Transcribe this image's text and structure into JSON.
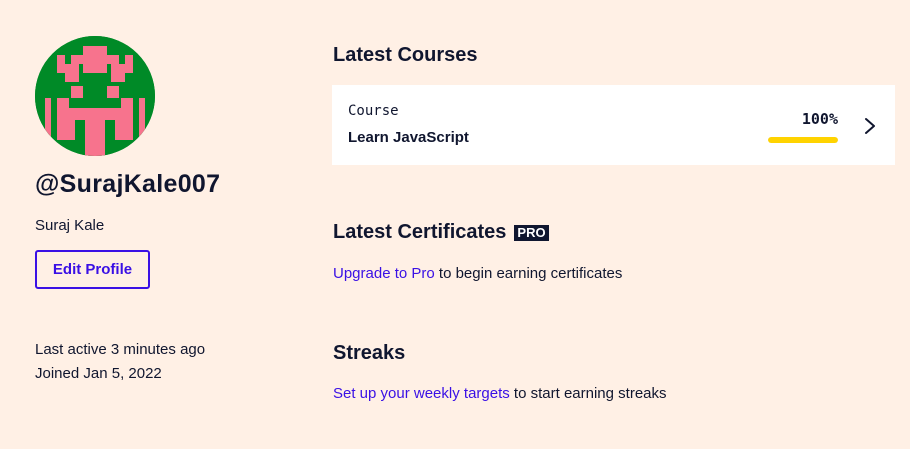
{
  "profile": {
    "username": "@SurajKale007",
    "full_name": "Suraj Kale",
    "edit_button_label": "Edit Profile",
    "last_active": "Last active 3 minutes ago",
    "joined": "Joined Jan 5, 2022",
    "avatar_colors": {
      "background": "#008a27",
      "pattern": "#f7738d"
    }
  },
  "latest_courses": {
    "heading": "Latest Courses",
    "card": {
      "type_label": "Course",
      "name": "Learn JavaScript",
      "progress_label": "100%",
      "progress_fraction": 1.0,
      "progress_color": "#ffd300",
      "chevron_icon": "chevron-right-icon"
    }
  },
  "latest_certificates": {
    "heading": "Latest Certificates",
    "badge": "PRO",
    "link_text": "Upgrade to Pro",
    "suffix_text": " to begin earning certificates"
  },
  "streaks": {
    "heading": "Streaks",
    "link_text": "Set up your weekly targets",
    "suffix_text": " to start earning streaks"
  },
  "colors": {
    "page_background": "#fff0e5",
    "text": "#10162f",
    "accent": "#3a10e5"
  }
}
